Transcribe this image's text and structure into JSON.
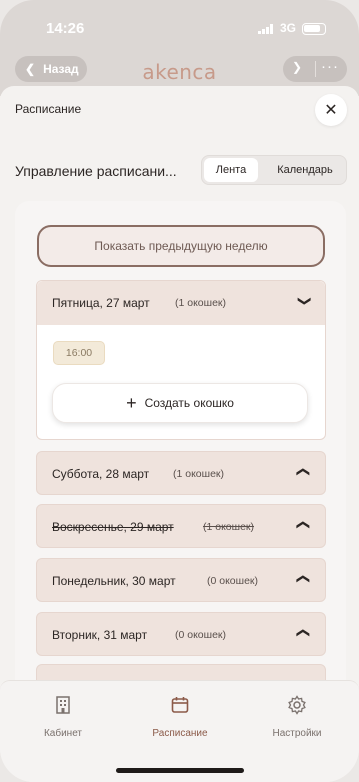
{
  "status_bar": {
    "time": "14:26",
    "network": "3G"
  },
  "header": {
    "back_label": "Назад",
    "logo": "akenca"
  },
  "sheet": {
    "title": "Расписание",
    "section_title": "Управление расписани...",
    "segment": {
      "active": "Лента",
      "other": "Календарь"
    }
  },
  "schedule": {
    "prev_week_label": "Показать предыдущую неделю",
    "days": [
      {
        "name": "Пятница, 27 март",
        "count": "(1 окошек)",
        "expanded": true,
        "slots": [
          "16:00"
        ],
        "create_label": "Создать окошко"
      },
      {
        "name": "Суббота, 28 март",
        "count": "(1 окошек)"
      },
      {
        "name": "Воскресенье, 29 март",
        "count": "(1 окошек)"
      },
      {
        "name": "Понедельник, 30 март",
        "count": "(0 окошек)"
      },
      {
        "name": "Вторник, 31 март",
        "count": "(0 окошек)"
      }
    ]
  },
  "tabbar": {
    "tabs": [
      {
        "label": "Кабинет"
      },
      {
        "label": "Расписание",
        "active": true
      },
      {
        "label": "Настройки"
      }
    ]
  },
  "colors": {
    "accent": "#8b5a49",
    "day_bg": "#efe3dd",
    "slot_bg": "#f3ead9"
  }
}
